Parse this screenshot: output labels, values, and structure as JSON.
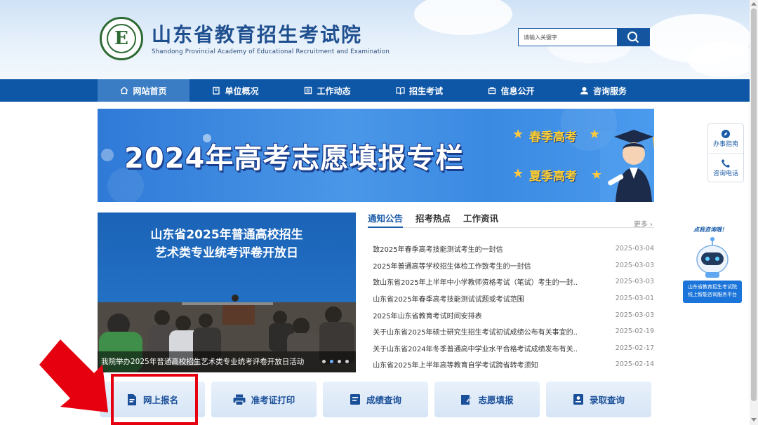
{
  "header": {
    "title_cn": "山东省教育招生考试院",
    "title_en": "Shandong Provincial Academy of Educational Recruitment and Examination",
    "logo_letter": "E"
  },
  "search": {
    "placeholder": "请输入关键字",
    "button_icon": "search-icon"
  },
  "nav": {
    "items": [
      {
        "label": "网站首页",
        "icon": "home-icon",
        "active": true
      },
      {
        "label": "单位概况",
        "icon": "building-icon",
        "active": false
      },
      {
        "label": "工作动态",
        "icon": "news-icon",
        "active": false
      },
      {
        "label": "招生考试",
        "icon": "book-icon",
        "active": false
      },
      {
        "label": "信息公开",
        "icon": "briefcase-icon",
        "active": false
      },
      {
        "label": "咨询服务",
        "icon": "user-service-icon",
        "active": false
      }
    ]
  },
  "banner": {
    "title": "2024年高考志愿填报专栏",
    "tag_spring": "春季高考",
    "tag_summer": "夏季高考"
  },
  "photo": {
    "headline_line1": "山东省2025年普通高校招生",
    "headline_line2": "艺术类专业统考评卷开放日",
    "caption": "我院举办2025年普通高校招生艺术类专业统考评卷开放日活动"
  },
  "news": {
    "tabs": [
      "通知公告",
      "招考热点",
      "工作资讯"
    ],
    "active_tab": "通知公告",
    "more_label": "更多",
    "items": [
      {
        "title": "致2025年春季高考技能测试考生的一封信",
        "date": "2025-03-04"
      },
      {
        "title": "2025年普通高等学校招生体检工作致考生的一封信",
        "date": "2025-03-03"
      },
      {
        "title": "致山东省2025年上半年中小学教师资格考试（笔试）考生的一封...",
        "date": "2025-03-03"
      },
      {
        "title": "山东省2025年春季高考技能测试试题或考试范围",
        "date": "2025-03-01"
      },
      {
        "title": "2025年山东省教育考试时间安排表",
        "date": "2025-03-03"
      },
      {
        "title": "关于山东省2025年硕士研究生招生考试初试成绩公布有关事宜的...",
        "date": "2025-02-19"
      },
      {
        "title": "关于山东省2024年冬季普通高中学业水平合格考试成绩发布有关...",
        "date": "2025-02-17"
      },
      {
        "title": "山东省2025年上半年高等教育自学考试跨省转考须知",
        "date": "2025-02-14"
      }
    ]
  },
  "quick_links": [
    {
      "label": "网上报名",
      "icon": "registration-icon"
    },
    {
      "label": "准考证打印",
      "icon": "printer-icon"
    },
    {
      "label": "成绩查询",
      "icon": "score-icon"
    },
    {
      "label": "志愿填报",
      "icon": "edit-icon"
    },
    {
      "label": "录取查询",
      "icon": "admission-icon"
    }
  ],
  "side_panel": {
    "items": [
      {
        "label": "办事指南",
        "icon": "compass-icon"
      },
      {
        "label": "咨询电话",
        "icon": "phone-icon"
      }
    ]
  },
  "assistant": {
    "bubble": "点我咨询哦！",
    "line1": "山东省教育招生考试院",
    "line2": "线上智能咨询服务平台"
  },
  "colors": {
    "primary": "#0e57a6",
    "nav_active": "#3a7dc4",
    "highlight": "#e6000f"
  }
}
